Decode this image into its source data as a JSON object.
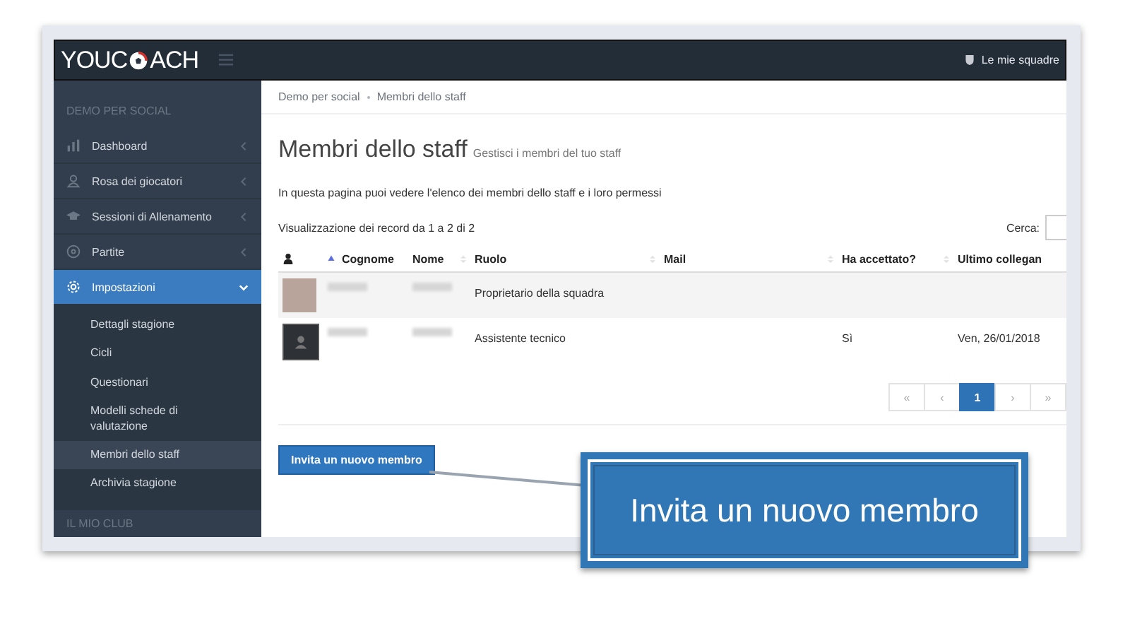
{
  "topbar": {
    "logo_left": "YOUC",
    "logo_right": "ACH",
    "teams_link": "Le mie squadre"
  },
  "sidebar": {
    "sections": [
      {
        "title": "DEMO PER SOCIAL",
        "items": [
          {
            "label": "Dashboard",
            "expanded": false,
            "selected": false
          },
          {
            "label": "Rosa dei giocatori",
            "expanded": false,
            "selected": false
          },
          {
            "label": "Sessioni di Allenamento",
            "expanded": false,
            "selected": false
          },
          {
            "label": "Partite",
            "expanded": false,
            "selected": false
          },
          {
            "label": "Impostazioni",
            "expanded": true,
            "selected": true,
            "children": [
              {
                "label": "Dettagli stagione",
                "selected": false
              },
              {
                "label": "Cicli",
                "selected": false
              },
              {
                "label": "Questionari",
                "selected": false
              },
              {
                "label": "Modelli schede di valutazione",
                "selected": false
              },
              {
                "label": "Membri dello staff",
                "selected": true
              },
              {
                "label": "Archivia stagione",
                "selected": false
              }
            ]
          }
        ]
      },
      {
        "title": "IL MIO CLUB"
      }
    ]
  },
  "breadcrumb": [
    "Demo per social",
    "Membri dello staff"
  ],
  "page": {
    "title": "Membri dello staff",
    "subtitle": "Gestisci i membri del tuo staff",
    "intro": "In questa pagina puoi vedere l'elenco dei membri dello staff e i loro permessi",
    "record_info": "Visualizzazione dei record da 1 a 2 di 2",
    "search_label": "Cerca:"
  },
  "table": {
    "columns": [
      {
        "kind": "icon"
      },
      {
        "kind": "text",
        "label": "Cognome",
        "sorted": true
      },
      {
        "kind": "text",
        "label": "Nome",
        "sorted": false
      },
      {
        "kind": "text",
        "label": "Ruolo",
        "sorted": false
      },
      {
        "kind": "text",
        "label": "Mail",
        "sorted": false
      },
      {
        "kind": "text",
        "label": "Ha accettato?",
        "sorted": false
      },
      {
        "kind": "text",
        "label": "Ultimo collegan",
        "sorted": false
      }
    ],
    "rows": [
      {
        "kind": "photo",
        "role": "Proprietario della squadra"
      },
      {
        "kind": "silhouette",
        "role": "Assistente tecnico",
        "accepted": "Sì",
        "last_login": "Ven, 26/01/2018"
      }
    ]
  },
  "pagination": [
    {
      "label": "«",
      "selected": false
    },
    {
      "label": "‹",
      "selected": false
    },
    {
      "label": "1",
      "selected": true
    },
    {
      "label": "›",
      "selected": false
    },
    {
      "label": "»",
      "selected": false
    }
  ],
  "invite_button": "Invita un nuovo membro",
  "callout": "Invita un nuovo membro"
}
